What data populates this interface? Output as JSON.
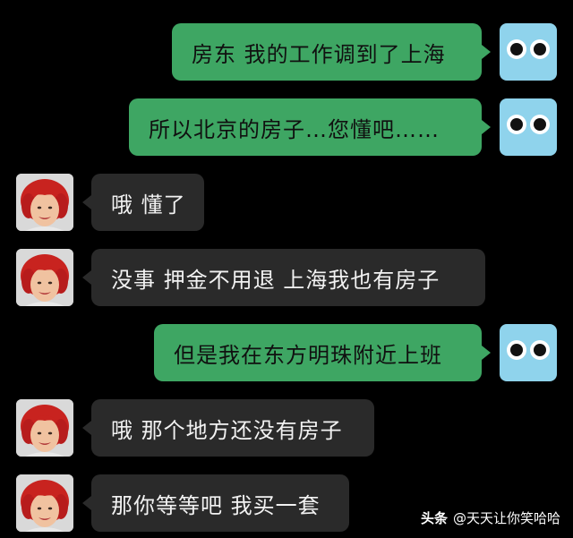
{
  "messages": [
    {
      "side": "sent",
      "text": "房东 我的工作调到了上海"
    },
    {
      "side": "sent",
      "text": "所以北京的房子…您懂吧……"
    },
    {
      "side": "recv",
      "text": "哦 懂了"
    },
    {
      "side": "recv",
      "text": "没事 押金不用退 上海我也有房子"
    },
    {
      "side": "sent",
      "text": "但是我在东方明珠附近上班"
    },
    {
      "side": "recv",
      "text": "哦 那个地方还没有房子"
    },
    {
      "side": "recv",
      "text": "那你等等吧 我买一套"
    }
  ],
  "watermark": {
    "brand": "头条",
    "handle": "@天天让你笑哈哈"
  },
  "colors": {
    "background": "#000000",
    "sent_bubble": "#3ea663",
    "received_bubble": "#2a2a2a",
    "sender_avatar": "#8fd3ec"
  },
  "icons": {
    "sender_avatar": "googly-eyes-avatar-icon",
    "receiver_avatar": "landlady-avatar-photo"
  }
}
